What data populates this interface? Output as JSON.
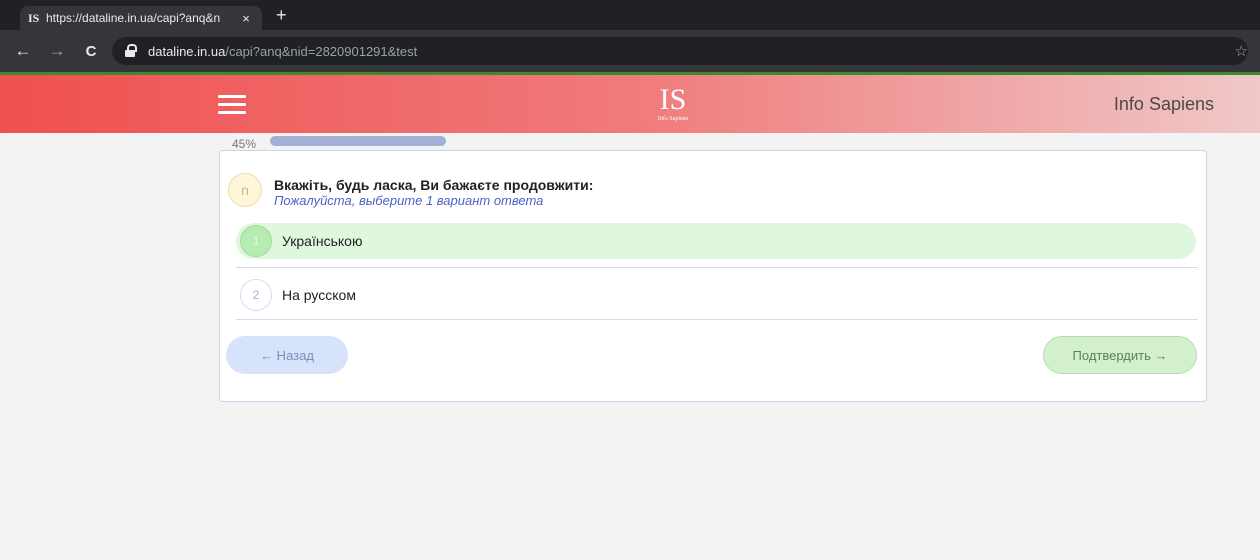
{
  "browser": {
    "tab": {
      "favicon_text": "IS",
      "title": "https://dataline.in.ua/capi?anq&n",
      "close_glyph": "×"
    },
    "new_tab_glyph": "+",
    "nav": {
      "back_glyph": "←",
      "forward_glyph": "→",
      "reload_glyph": "C"
    },
    "url": {
      "host": "dataline.in.ua",
      "path": "/capi?anq&nid=2820901291&test"
    },
    "star_glyph": "☆"
  },
  "header": {
    "logo_mark": "IS",
    "logo_sub": "Info Sapiens",
    "brand": "Info Sapiens",
    "colors": {
      "gradient_start": "#f05050",
      "gradient_end": "#f0c8c8"
    }
  },
  "progress": {
    "label": "45%",
    "value": 45
  },
  "question": {
    "badge": "n",
    "title": "Вкажіть, будь ласка, Ви бажаєте продовжити:",
    "hint": "Пожалуйста, выберите 1 вариант ответа",
    "options": [
      {
        "number": "1",
        "label": "Українською",
        "selected": true
      },
      {
        "number": "2",
        "label": "На русском",
        "selected": false
      }
    ]
  },
  "buttons": {
    "back": "← Назад",
    "next": "Подтвердить →"
  }
}
